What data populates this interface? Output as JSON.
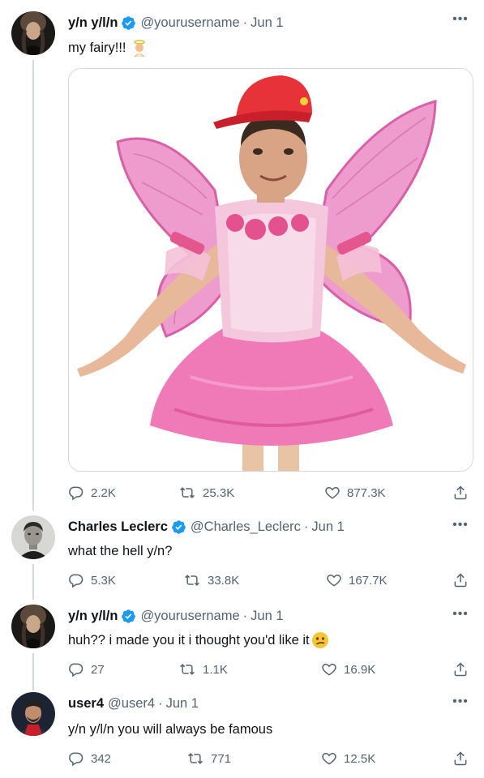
{
  "tweets": [
    {
      "name": "y/n y/l/n",
      "handle": "@yourusername",
      "sep": "·",
      "date": "Jun 1",
      "text": "my fairy!!!",
      "emoji": "angel-emoji",
      "verified": true,
      "replies": "2.2K",
      "retweets": "25.3K",
      "likes": "877.3K"
    },
    {
      "name": "Charles Leclerc",
      "handle": "@Charles_Leclerc",
      "sep": "·",
      "date": "Jun 1",
      "text": "what the hell y/n?",
      "verified": true,
      "replies": "5.3K",
      "retweets": "33.8K",
      "likes": "167.7K"
    },
    {
      "name": "y/n y/l/n",
      "handle": "@yourusername",
      "sep": "·",
      "date": "Jun 1",
      "text": "huh?? i made you it i thought you'd like it",
      "emoji": "confused-face-emoji",
      "verified": true,
      "replies": "27",
      "retweets": "1.1K",
      "likes": "16.9K"
    },
    {
      "name": "user4",
      "handle": "@user4",
      "sep": "·",
      "date": "Jun 1",
      "text": "y/n y/l/n you will always be famous",
      "verified": false,
      "replies": "342",
      "retweets": "771",
      "likes": "12.5K"
    }
  ],
  "more_glyph": "•••",
  "colors": {
    "verified": "#1d9bf0",
    "secondary_text": "#536471",
    "thread_line": "#cfd9de",
    "fairy_pink": "#f07ab8",
    "cap_red": "#e8323a"
  },
  "icons": [
    "reply-icon",
    "retweet-icon",
    "like-icon",
    "share-icon",
    "verified-badge-icon",
    "more-icon"
  ]
}
